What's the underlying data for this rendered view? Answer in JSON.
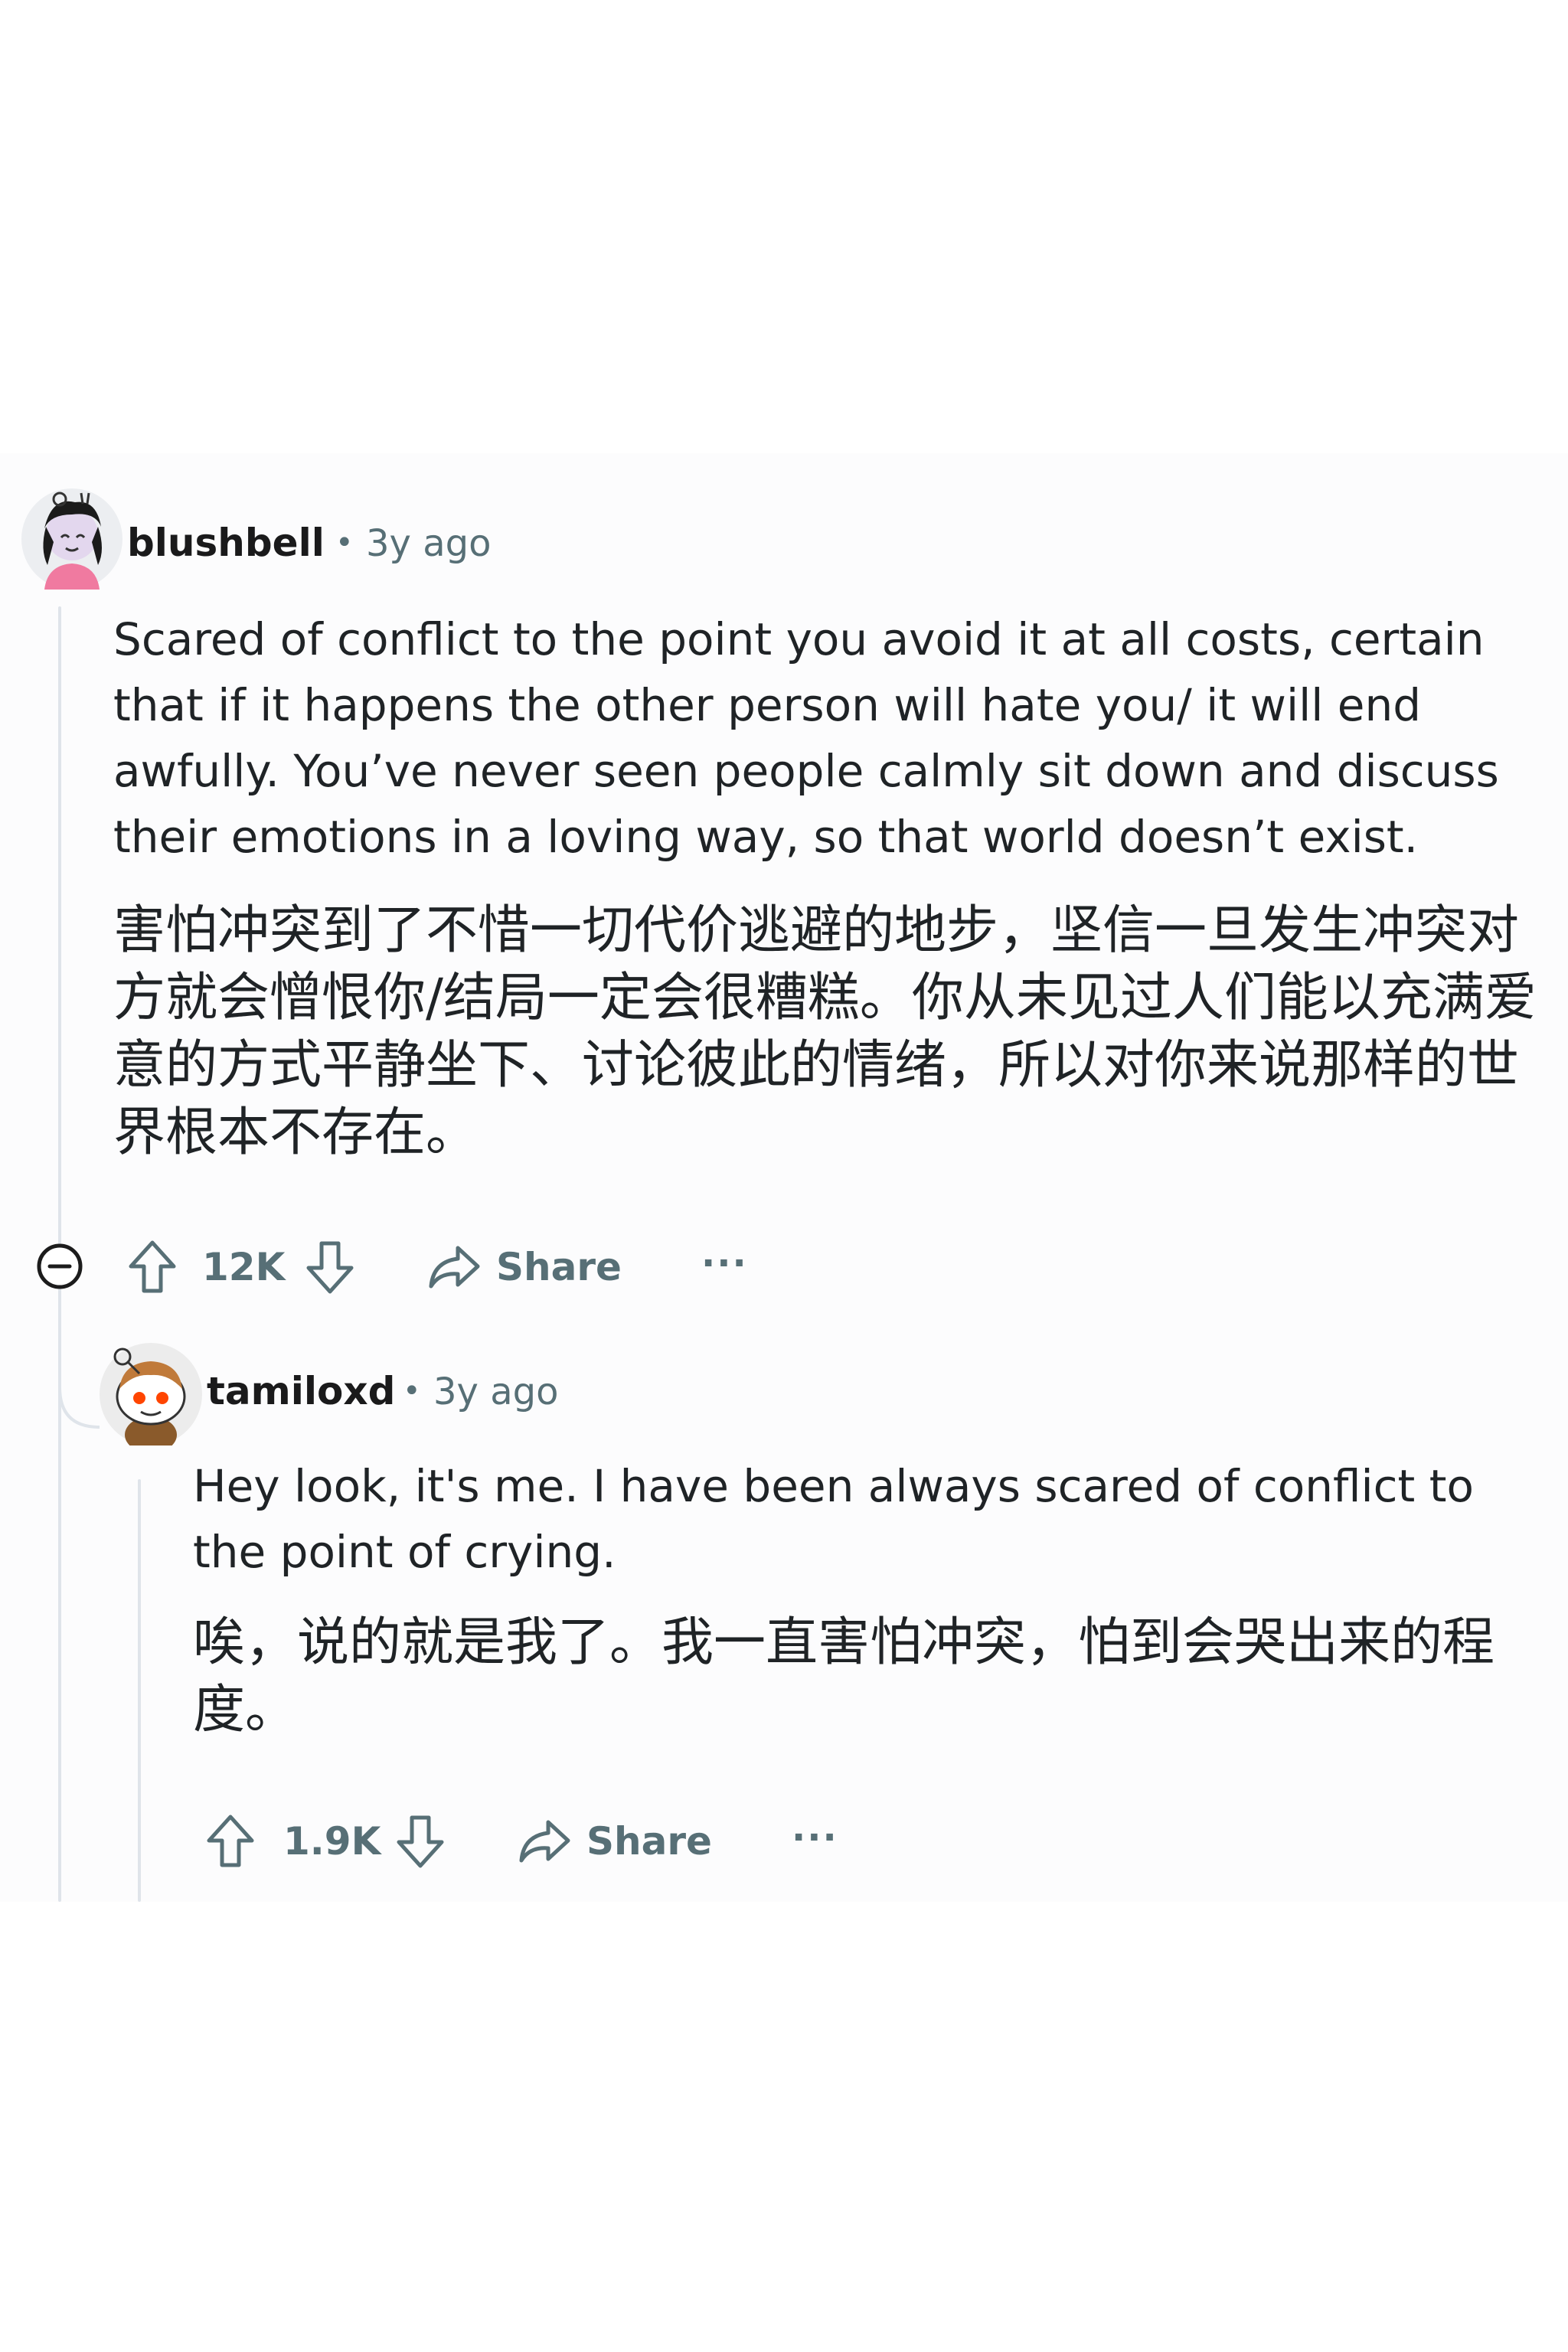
{
  "comments": [
    {
      "username": "blushbell",
      "dot": "•",
      "time": "3y ago",
      "text_en": "Scared of conflict to the point you avoid it at all costs, certain that if it happens the other person will hate you/ it will end awfully. You’ve never seen people calmly sit down and discuss their emotions in a loving way, so that world doesn’t exist.",
      "text_zh": "害怕冲突到了不惜一切代价逃避的地步，坚信一旦发生冲突对方就会憎恨你/结局一定会很糟糕。你从未见过人们能以充满爱意的方式平静坐下、讨论彼此的情绪，所以对你来说那样的世界根本不存在。",
      "votes": "12K",
      "share_label": "Share",
      "more_label": "···"
    },
    {
      "username": "tamiloxd",
      "dot": "•",
      "time": "3y ago",
      "text_en": "Hey look, it's me. I have been always scared of conflict to the point of crying.",
      "text_zh": "唉，说的就是我了。我一直害怕冲突，怕到会哭出来的程度。",
      "votes": "1.9K",
      "share_label": "Share",
      "more_label": "···"
    }
  ],
  "icons": {
    "collapse": "collapse-icon",
    "upvote": "upvote-icon",
    "downvote": "downvote-icon",
    "share": "share-icon",
    "more": "more-icon"
  },
  "colors": {
    "meta": "#576f76",
    "thread_line": "#dfe4ea",
    "panel": "#fcfcfd"
  }
}
